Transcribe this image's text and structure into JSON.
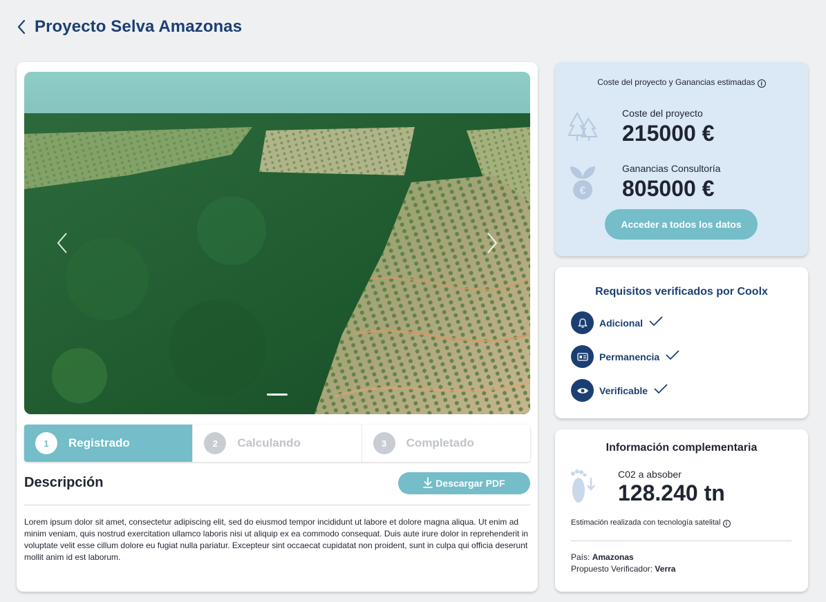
{
  "header": {
    "title": "Proyecto Selva Amazonas"
  },
  "carousel": {
    "image_alt": "Vista aérea de selva amazónica y deforestación",
    "active_slide": 1
  },
  "steps": [
    {
      "number": "1",
      "label": "Registrado",
      "active": true
    },
    {
      "number": "2",
      "label": "Calculando",
      "active": false
    },
    {
      "number": "3",
      "label": "Completado",
      "active": false
    }
  ],
  "description": {
    "title": "Descripción",
    "download_label": "Descargar PDF",
    "text": "Lorem ipsum dolor sit amet, consectetur adipiscing elit, sed do eiusmod tempor incididunt ut labore et dolore magna aliqua. Ut enim ad minim veniam, quis nostrud exercitation ullamco laboris nisi ut aliquip ex ea commodo consequat. Duis aute irure dolor in reprehenderit in voluptate velit esse cillum dolore eu fugiat nulla pariatur. Excepteur sint occaecat cupidatat non proident, sunt in culpa qui officia deserunt mollit anim id est laborum."
  },
  "costs": {
    "heading": "Coste del proyecto y Ganancias estimadas",
    "project_cost_label": "Coste del proyecto",
    "project_cost_value": "215000 €",
    "earnings_label": "Ganancias Consultoría",
    "earnings_value": "805000 €",
    "access_button": "Acceder a todos los datos"
  },
  "requirements": {
    "title": "Requisitos verificados por Coolx",
    "items": [
      {
        "label": "Adicional",
        "icon": "bell-icon"
      },
      {
        "label": "Permanencia",
        "icon": "id-card-icon"
      },
      {
        "label": "Verificable",
        "icon": "eye-icon"
      }
    ]
  },
  "info": {
    "title": "Información complementaria",
    "co2_label": "C02 a absober",
    "co2_value": "128.240 tn",
    "estimation": "Estimación realizada con tecnología satelital",
    "country_label": "País:",
    "country_value": "Amazonas",
    "verifier_label": "Propuesto Verificador:",
    "verifier_value": "Verra"
  },
  "colors": {
    "primary": "#1b3f73",
    "accent": "#74bdc9",
    "cost_bg": "#dbe8f6"
  }
}
